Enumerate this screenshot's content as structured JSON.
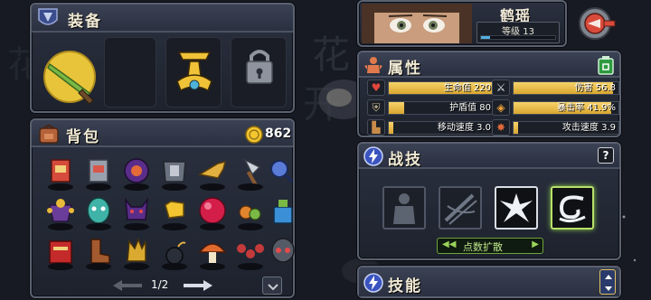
{
  "equipment": {
    "title": "装备"
  },
  "character": {
    "name": "鹤瑶",
    "level_label": "等级 13",
    "level_progress": 0.12
  },
  "attributes": {
    "title": "属性",
    "stats": [
      {
        "label": "生命值 220",
        "fill": 1.0
      },
      {
        "label": "伤害 56.8",
        "fill": 0.95
      },
      {
        "label": "护盾值 80",
        "fill": 0.15
      },
      {
        "label": "暴击率 41.9%",
        "fill": 0.93
      },
      {
        "label": "移动速度 3.0",
        "fill": 0.04
      },
      {
        "label": "攻击速度 3.9",
        "fill": 0.04
      }
    ]
  },
  "backpack": {
    "title": "背包",
    "gold": "862",
    "page": "1/2"
  },
  "combat_skills": {
    "title": "战技",
    "help": "?",
    "spread_button": "点数扩散"
  },
  "skills": {
    "title": "技能"
  },
  "icons": {
    "back": "back-arrow-icon",
    "lock": "lock-icon",
    "gold": "gold-coin-icon",
    "help": "help-icon",
    "recycle": "recycle-icon"
  }
}
